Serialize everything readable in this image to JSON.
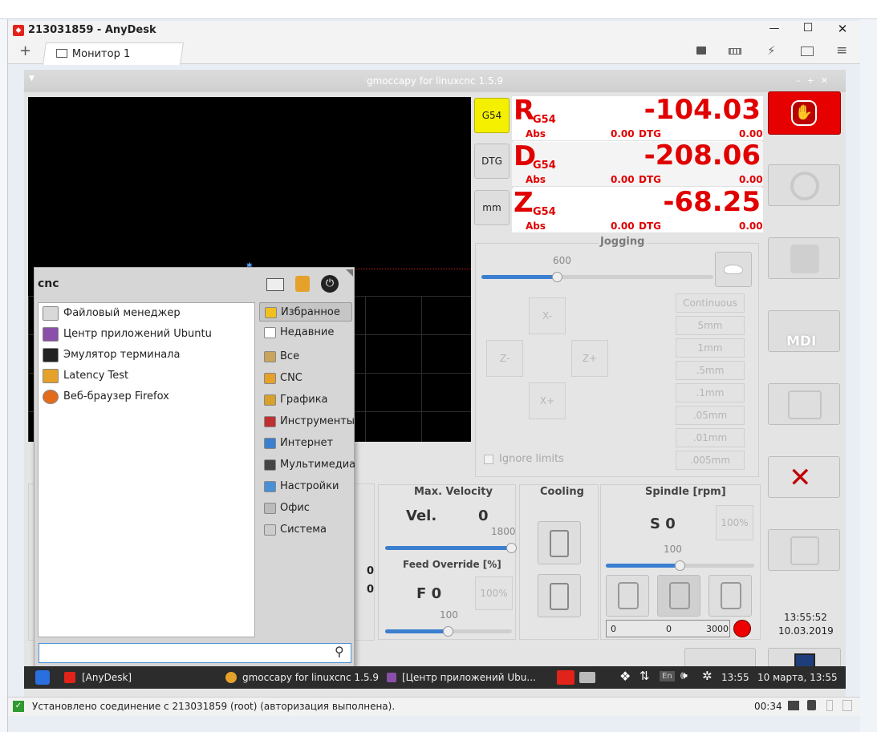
{
  "anydesk": {
    "window_title": "213031859 - AnyDesk",
    "tab_label": "Монитор 1",
    "add_tab": "+",
    "win_minimize": "—",
    "win_maximize": "☐",
    "win_close": "✕",
    "status_text": "Установлено соединение с 213031859 (root) (авторизация выполнена).",
    "session_time": "00:34"
  },
  "gmoccapy": {
    "window_title": "gmoccapy for linuxcnc  1.5.9",
    "coord_button": "G54",
    "dtg_button": "DTG",
    "units_button": "mm",
    "axes": [
      {
        "letter": "R",
        "sub": "G54",
        "value": "-104.03",
        "abs_label": "Abs",
        "abs_value": "0.00",
        "dtg_label": "DTG",
        "dtg_value": "0.00"
      },
      {
        "letter": "D",
        "sub": "G54",
        "value": "-208.06",
        "abs_label": "Abs",
        "abs_value": "0.00",
        "dtg_label": "DTG",
        "dtg_value": "0.00"
      },
      {
        "letter": "Z",
        "sub": "G54",
        "value": "-68.25",
        "abs_label": "Abs",
        "abs_value": "0.00",
        "dtg_label": "DTG",
        "dtg_value": "0.00"
      }
    ],
    "jogging": {
      "title": "Jogging",
      "speed": "600",
      "speed_fraction": 0.33,
      "x_minus": "X-",
      "x_plus": "X+",
      "z_minus": "Z-",
      "z_plus": "Z+",
      "increments": [
        "Continuous",
        "5mm",
        "1mm",
        ".5mm",
        ".1mm",
        ".05mm",
        ".01mm",
        ".005mm"
      ],
      "ignore_limits": "Ignore limits"
    },
    "velocity": {
      "title": "Max. Velocity",
      "label": "Vel.",
      "value": "0",
      "max": "1800",
      "fraction": 1.0
    },
    "feed": {
      "title": "Feed Override [%]",
      "label": "F  0",
      "reset": "100%",
      "value": "100",
      "fraction": 0.5
    },
    "cooling": {
      "title": "Cooling"
    },
    "spindle": {
      "title": "Spindle [rpm]",
      "label": "S 0",
      "reset": "100%",
      "override": "100",
      "fraction": 0.5,
      "bar_left": "0",
      "bar_mid": "0",
      "bar_right": "3000"
    },
    "side": {
      "mdi": "MDI",
      "time": "13:55:52",
      "date": "10.03.2019"
    },
    "left_values": [
      "0",
      "0"
    ]
  },
  "menu": {
    "user": "cnc",
    "apps": [
      "Файловый менеджер",
      "Центр приложений Ubuntu",
      "Эмулятор терминала",
      "Latency Test",
      "Веб-браузер Firefox"
    ],
    "categories": [
      "Избранное",
      "Недавние",
      "Все",
      "CNC",
      "Графика",
      "Инструменты",
      "Интернет",
      "Мультимедиа",
      "Настройки",
      "Офис",
      "Система"
    ],
    "search_value": ""
  },
  "taskbar": {
    "items": [
      "[AnyDesk]",
      "gmoccapy for linuxcnc  1.5.9",
      "[Центр приложений Ubu..."
    ],
    "lang": "En",
    "time": "13:55",
    "datetime": "10 марта, 13:55"
  },
  "colors": {
    "estop": "#e60000",
    "dro": "#e00000",
    "accent": "#3b7fd0",
    "g54_active": "#f5f000"
  }
}
